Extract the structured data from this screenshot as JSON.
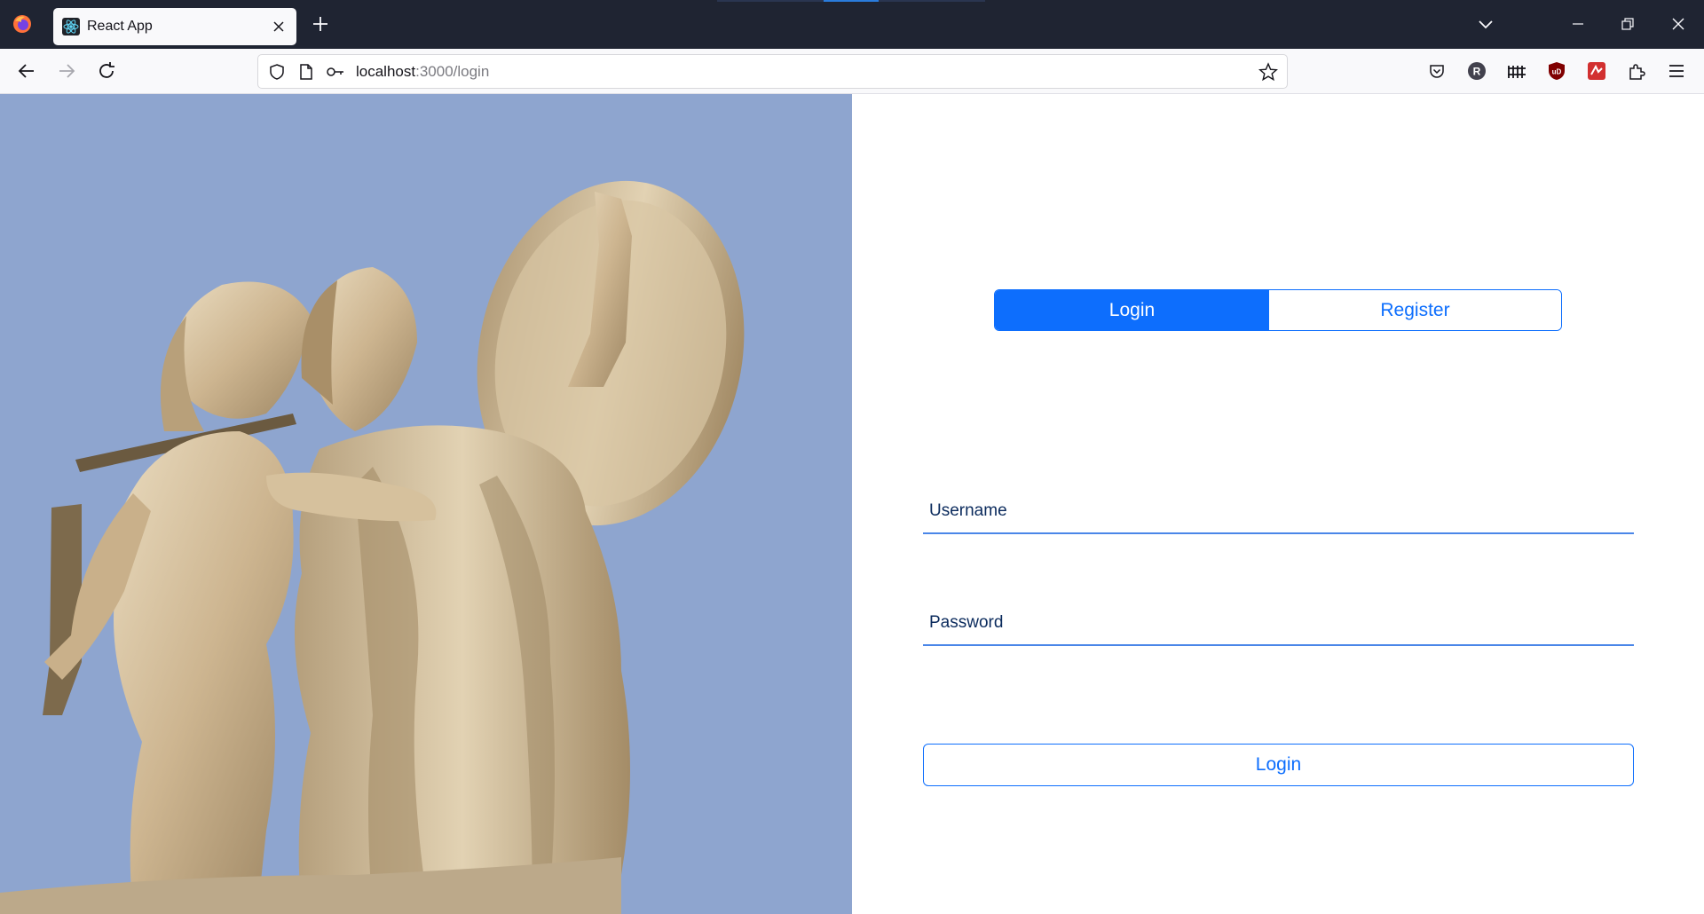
{
  "browser": {
    "tab_title": "React App",
    "url_host": "localhost",
    "url_path": ":3000/login",
    "accent": "#0d6efd"
  },
  "icons": {
    "firefox": "firefox-icon",
    "react": "react-icon",
    "close": "close-icon",
    "new_tab": "plus-icon",
    "back": "back-arrow-icon",
    "forward": "forward-arrow-icon",
    "reload": "reload-icon",
    "shield": "shield-icon",
    "page": "page-icon",
    "key": "key-icon",
    "bookmark": "star-icon",
    "pocket": "pocket-icon",
    "menu": "hamburger-icon"
  },
  "auth": {
    "tabs": [
      {
        "label": "Login",
        "active": true
      },
      {
        "label": "Register",
        "active": false
      }
    ],
    "username_label": "Username",
    "password_label": "Password",
    "submit_label": "Login"
  },
  "extensions": {
    "profile_letter": "R",
    "ublock_letter": "uD"
  }
}
